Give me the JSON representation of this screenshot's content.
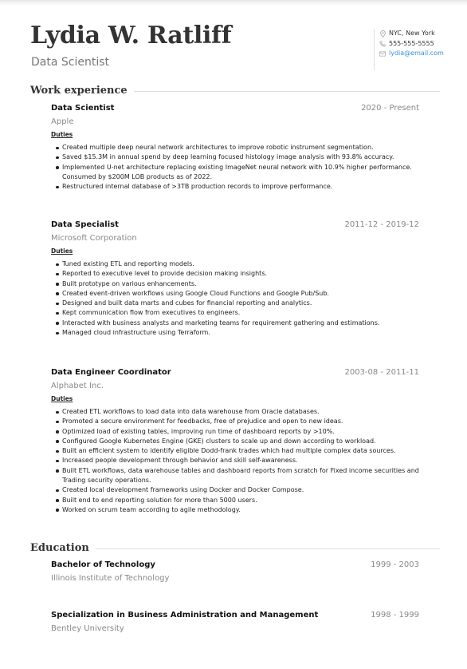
{
  "header": {
    "name": "Lydia W. Ratliff",
    "title": "Data Scientist"
  },
  "contact": {
    "location": "NYC, New York",
    "location_icon": "map-pin-icon",
    "phone": "555-555-5555",
    "phone_icon": "phone-icon",
    "email": "lydia@email.com",
    "email_icon": "envelope-icon",
    "email_color": "#3b8fd6"
  },
  "work_experience": {
    "heading": "Work experience",
    "jobs": [
      {
        "role": "Data Scientist",
        "company": "Apple",
        "dates": "2020 - Present",
        "duties_label": "Duties",
        "duties": [
          "Created multiple deep neural network architectures to improve robotic instrument segmentation.",
          "Saved $15.3M in annual spend by deep learning focused histology image analysis with 93.8% accuracy.",
          "Implemented U-net architecture replacing existing ImageNet neural network with 10.9% higher performance. Consumed by $200M LOB products as of 2022.",
          "Restructured internal database of >3TB production records to improve performance."
        ]
      },
      {
        "role": "Data Specialist",
        "company": "Microsoft Corporation",
        "dates": "2011-12 - 2019-12",
        "duties_label": "Duties",
        "duties": [
          "Tuned existing ETL and reporting models.",
          "Reported to executive level to provide decision making insights.",
          "Built prototype on various enhancements.",
          "Created event-driven workflows using Google Cloud Functions and Google Pub/Sub.",
          "Designed and built data marts and cubes for financial reporting and analytics.",
          "Kept communication flow from executives to engineers.",
          "Interacted with business analysts and marketing teams for requirement gathering and estimations.",
          "Managed cloud infrastructure using Terraform."
        ]
      },
      {
        "role": "Data Engineer Coordinator",
        "company": "Alphabet Inc.",
        "dates": "2003-08 - 2011-11",
        "duties_label": "Duties",
        "duties": [
          "Created ETL workflows to load data into data warehouse from Oracle databases.",
          "Promoted a secure environment for feedbacks, free of prejudice and open to new ideas.",
          "Optimized load of existing tables, improving run time of dashboard reports by >10%.",
          "Configured Google Kubernetes Engine (GKE) clusters to scale up and down according to workload.",
          "Built an efficient system to identify eligible Dodd-frank trades which had multiple complex data sources.",
          "Increased people development through behavior and skill self-awareness.",
          "Built ETL workflows, data warehouse tables and dashboard reports from scratch for Fixed income securities and Trading security operations.",
          "Created local development frameworks using Docker and Docker Compose.",
          "Built end to end reporting solution for more than 5000 users.",
          "Worked on scrum team according to agile methodology."
        ]
      }
    ]
  },
  "education": {
    "heading": "Education",
    "items": [
      {
        "degree": "Bachelor of Technology",
        "school": "Illinois Institute of Technology",
        "dates": "1999 - 2003"
      },
      {
        "degree": "Specialization in Business Administration and Management",
        "school": "Bentley University",
        "dates": "1998 - 1999"
      }
    ]
  }
}
